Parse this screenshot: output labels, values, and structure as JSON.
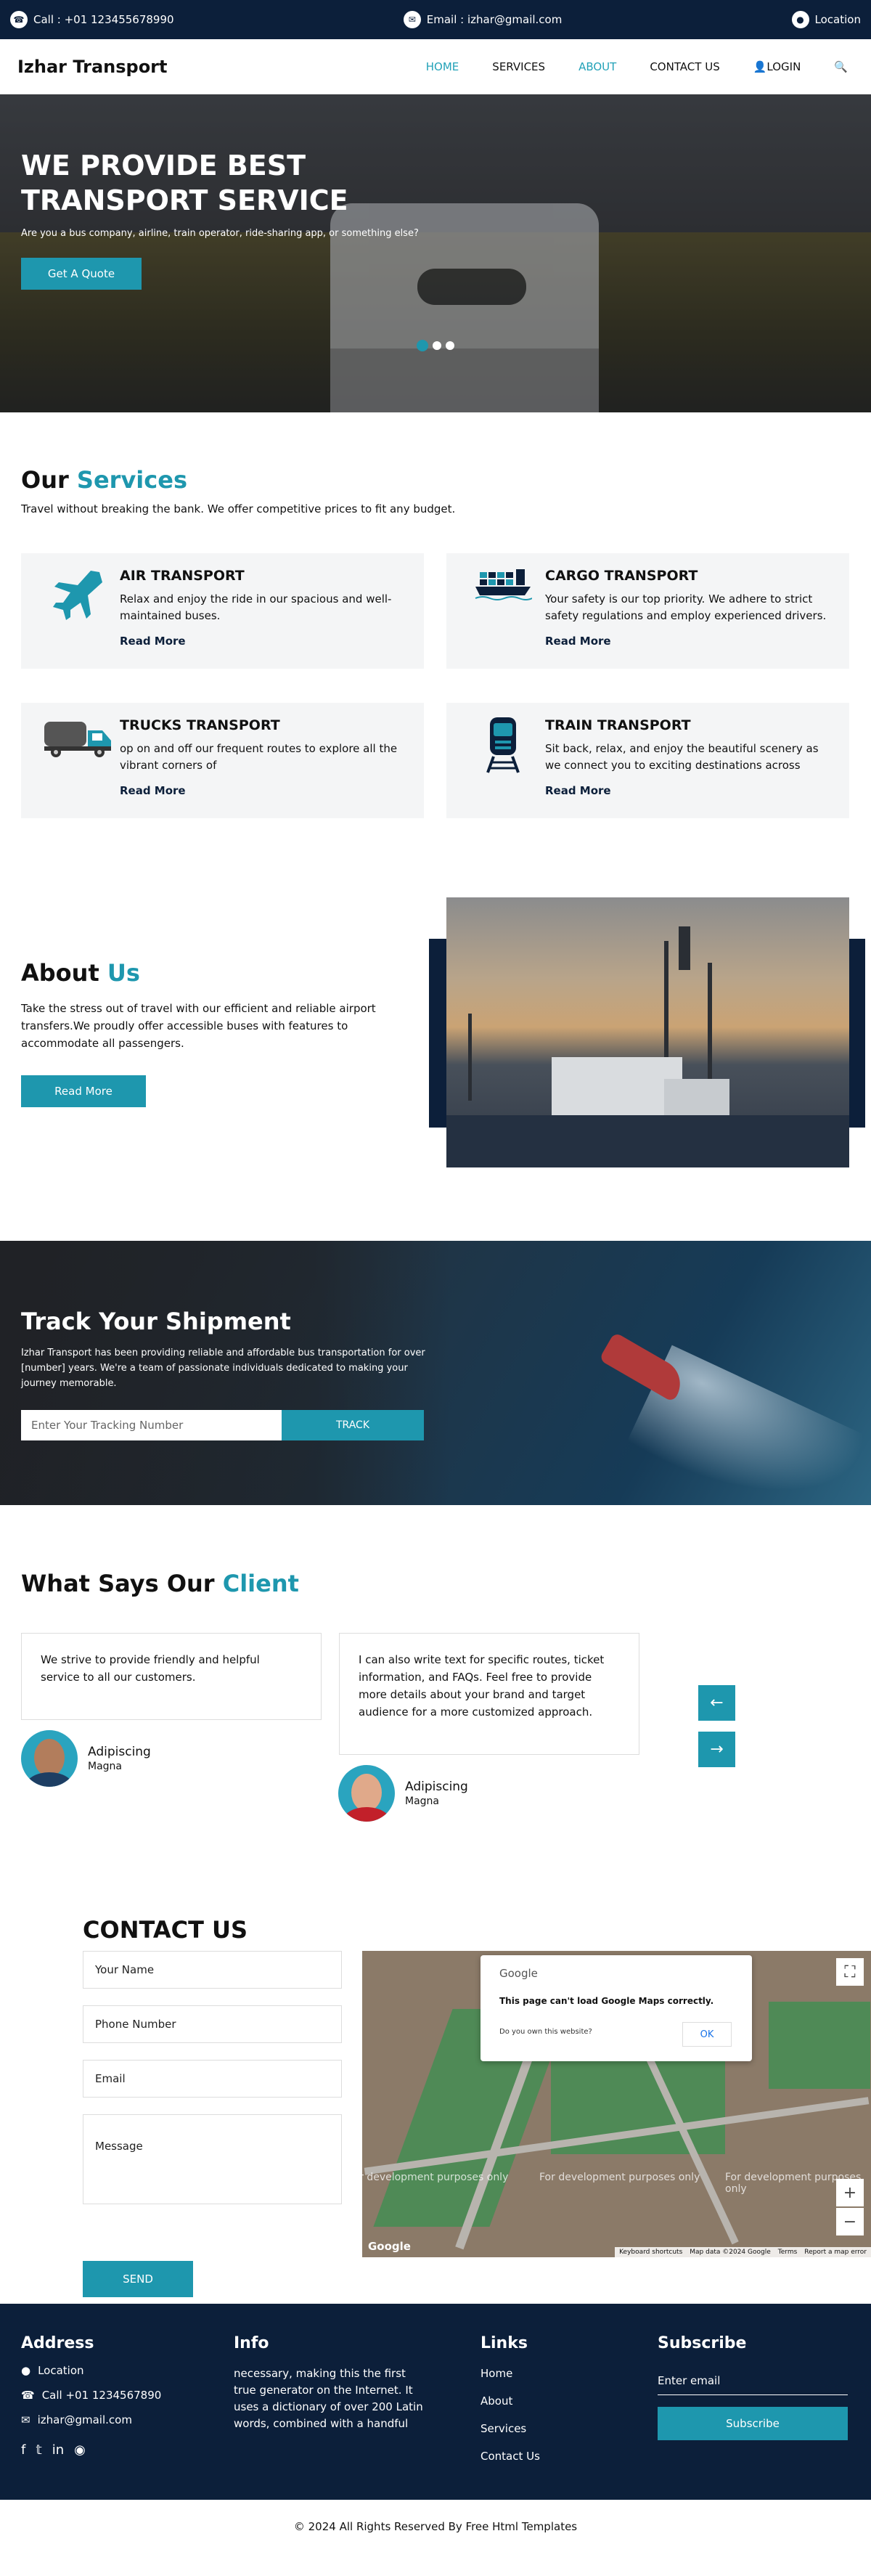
{
  "topbar": {
    "call": "Call : +01 123455678990",
    "email": "Email : izhar@gmail.com",
    "location": "Location"
  },
  "nav": {
    "brand": "Izhar Transport",
    "items": [
      "HOME",
      "SERVICES",
      "ABOUT",
      "CONTACT US"
    ],
    "login": "LOGIN"
  },
  "hero": {
    "title": "WE PROVIDE BEST TRANSPORT SERVICE",
    "subtitle": "Are you a bus company, airline, train operator, ride-sharing app, or something else?",
    "cta": "Get A Quote"
  },
  "services": {
    "title_a": "Our",
    "title_b": "Services",
    "subtitle": "Travel without breaking the bank. We offer competitive prices to fit any budget.",
    "cards": [
      {
        "icon": "airplane-icon",
        "title": "AIR TRANSPORT",
        "text": "Relax and enjoy the ride in our spacious and well-maintained buses.",
        "link": "Read More"
      },
      {
        "icon": "cargo-ship-icon",
        "title": "CARGO TRANSPORT",
        "text": "Your safety is our top priority. We adhere to strict safety regulations and employ experienced drivers.",
        "link": "Read More"
      },
      {
        "icon": "truck-icon",
        "title": "TRUCKS TRANSPORT",
        "text": "op on and off our frequent routes to explore all the vibrant corners of",
        "link": "Read More"
      },
      {
        "icon": "train-icon",
        "title": "TRAIN TRANSPORT",
        "text": "Sit back, relax, and enjoy the beautiful scenery as we connect you to exciting destinations across",
        "link": "Read More"
      }
    ]
  },
  "about": {
    "title_a": "About",
    "title_b": "Us",
    "text": "Take the stress out of travel with our efficient and reliable airport transfers.We proudly offer accessible buses with features to accommodate all passengers.",
    "cta": "Read More"
  },
  "track": {
    "title": "Track Your Shipment",
    "text": "Izhar Transport has been providing reliable and affordable bus transportation for over [number] years. We're a team of passionate individuals dedicated to making your journey memorable.",
    "placeholder": "Enter Your Tracking Number",
    "button": "TRACK"
  },
  "testimonials": {
    "title_a": "What Says Our",
    "title_b": "Client",
    "items": [
      {
        "text": "We strive to provide friendly and helpful service to all our customers.",
        "name": "Adipiscing",
        "role": "Magna"
      },
      {
        "text": "I can also write text for specific routes, ticket information, and FAQs. Feel free to provide more details about your brand and target audience for a more customized approach.",
        "name": "Adipiscing",
        "role": "Magna"
      }
    ]
  },
  "contact": {
    "title": "CONTACT US",
    "fields": [
      "Your Name",
      "Phone Number",
      "Email",
      "Message"
    ],
    "send": "SEND",
    "map": {
      "brand": "Google",
      "error_title": "This page can't load Google Maps correctly.",
      "question": "Do you own this website?",
      "ok": "OK",
      "dev_text": "For development purposes only",
      "attribution": [
        "Keyboard shortcuts",
        "Map data ©2024 Google",
        "Terms",
        "Report a map error"
      ]
    }
  },
  "footer": {
    "address_title": "Address",
    "address_items": [
      "Location",
      "Call +01 1234567890",
      "izhar@gmail.com"
    ],
    "info_title": "Info",
    "info_text": "necessary, making this the first true generator on the Internet. It uses a dictionary of over 200 Latin words, combined with a handful",
    "links_title": "Links",
    "links": [
      "Home",
      "About",
      "Services",
      "Contact Us"
    ],
    "subscribe_title": "Subscribe",
    "subscribe_placeholder": "Enter email",
    "subscribe_button": "Subscribe",
    "copyright": "© 2024 All Rights Reserved By Free Html Templates"
  }
}
